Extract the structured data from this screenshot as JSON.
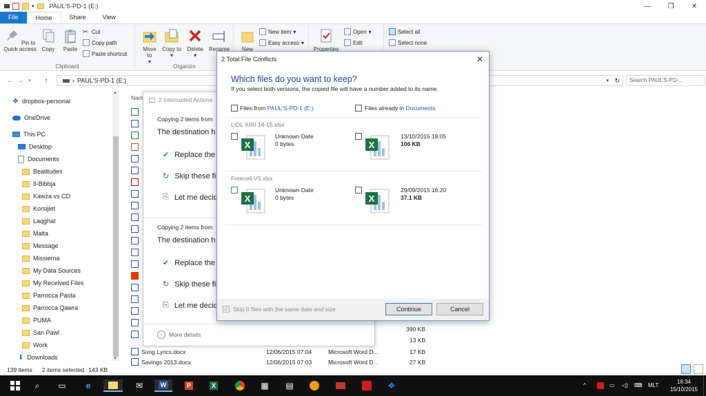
{
  "window": {
    "title": "PAUL'S-PD-1 (E:)",
    "controls": [
      "—",
      "❐",
      "✕"
    ]
  },
  "ribbon_tabs": [
    "File",
    "Home",
    "Share",
    "View"
  ],
  "ribbon": {
    "clipboard": {
      "pin": "Pin to Quick access",
      "copy": "Copy",
      "paste": "Paste",
      "cut": "Cut",
      "copy_path": "Copy path",
      "paste_shortcut": "Paste shortcut",
      "label": "Clipboard"
    },
    "organize": {
      "move_to": "Move to",
      "copy_to": "Copy to",
      "delete": "Delete",
      "rename": "Rename",
      "label": "Organize"
    },
    "new": {
      "new_folder": "New",
      "new_item": "New item",
      "easy_access": "Easy access"
    },
    "open": {
      "properties": "Properties",
      "open": "Open",
      "edit": "Edit"
    },
    "select": {
      "select_all": "Select all",
      "select_none": "Select none"
    }
  },
  "address": {
    "path": "PAUL'S-PD-1 (E:)",
    "search_placeholder": "Search PAUL'S-PD-..."
  },
  "nav": {
    "items": [
      {
        "label": "dropbox-personal",
        "icon": "dropbox-icon"
      },
      {
        "label": "OneDrive",
        "icon": "onedrive-icon"
      },
      {
        "label": "This PC",
        "icon": "pc-icon"
      },
      {
        "label": "Desktop",
        "icon": "desktop-icon"
      },
      {
        "label": "Documents",
        "icon": "documents-icon"
      },
      {
        "label": "Beatitudes",
        "icon": "folder-icon"
      },
      {
        "label": "Il-Bibbja",
        "icon": "folder-icon"
      },
      {
        "label": "Kawza vs CD",
        "icon": "folder-icon"
      },
      {
        "label": "Korsijiet",
        "icon": "folder-icon"
      },
      {
        "label": "Laqghat",
        "icon": "folder-icon"
      },
      {
        "label": "Malta",
        "icon": "folder-icon"
      },
      {
        "label": "Message",
        "icon": "folder-icon"
      },
      {
        "label": "Missierna",
        "icon": "folder-icon"
      },
      {
        "label": "My Data Sources",
        "icon": "folder-icon"
      },
      {
        "label": "My Received Files",
        "icon": "folder-icon"
      },
      {
        "label": "Parrocca Paola",
        "icon": "folder-icon"
      },
      {
        "label": "Parrocca Qawra",
        "icon": "folder-icon"
      },
      {
        "label": "PUMA",
        "icon": "folder-icon"
      },
      {
        "label": "San Pawl",
        "icon": "folder-icon"
      },
      {
        "label": "Work",
        "icon": "folder-icon"
      },
      {
        "label": "Downloads",
        "icon": "downloads-icon"
      }
    ]
  },
  "filelist": {
    "col_name_partial": "Nam",
    "visible_sizes": [
      "390 KB",
      "13 KB"
    ],
    "rows": [
      {
        "name": "Song Lyrics.docx",
        "date": "12/06/2015 07:04",
        "type": "Microsoft Word D...",
        "size": "17 KB"
      },
      {
        "name": "Savings 2013.docx",
        "date": "12/06/2015 07:03",
        "type": "Microsoft Word D...",
        "size": "27 KB"
      }
    ]
  },
  "status": {
    "items": "139 items",
    "selected": "2 items selected",
    "size": "143 KB"
  },
  "progress_dialog": {
    "title": "2 Interrupted Actions",
    "block1_copying": "Copying 2 items from",
    "block1_dest": "The destination h",
    "block1_replace": "Replace the",
    "block1_skip": "Skip these fil",
    "block1_decide": "Let me decid",
    "block2_copying": "Copying 2 items from",
    "block2_dest": "The destination h",
    "block2_replace": "Replace the",
    "block2_skip": "Skip these fil",
    "block2_decide": "Let me decid",
    "more_details": "More details"
  },
  "conflict_dialog": {
    "title": "2 Total File Conflicts",
    "heading": "Which files do you want to keep?",
    "subheading": "If you select both versions, the copied file will have a number added to its name.",
    "from_label": "Files from ",
    "from_link": "PAUL'S-PD-1 (E:)",
    "already_label": "Files already in ",
    "already_link": "Documents",
    "files": [
      {
        "name": "LIDL XIRI 14-15.xlsx",
        "source_date": "Unknown Date",
        "source_size": "0 bytes",
        "dest_date": "13/10/2015 18:05",
        "dest_size": "106 KB"
      },
      {
        "name": "Freecell-V5.xlsx",
        "source_date": "Unknown Date",
        "source_size": "0 bytes",
        "dest_date": "29/09/2015 16:20",
        "dest_size": "37.1 KB"
      }
    ],
    "skip_label": "Skip 0 files with the same date and size",
    "continue": "Continue",
    "cancel": "Cancel"
  },
  "tray": {
    "language": "MLT",
    "time": "16:34",
    "date": "15/10/2015"
  },
  "colors": {
    "accent": "#1979ca",
    "link": "#1e5aaa",
    "heading": "#1e3f9a",
    "excel": "#1e7145",
    "taskbar": "#101010"
  }
}
